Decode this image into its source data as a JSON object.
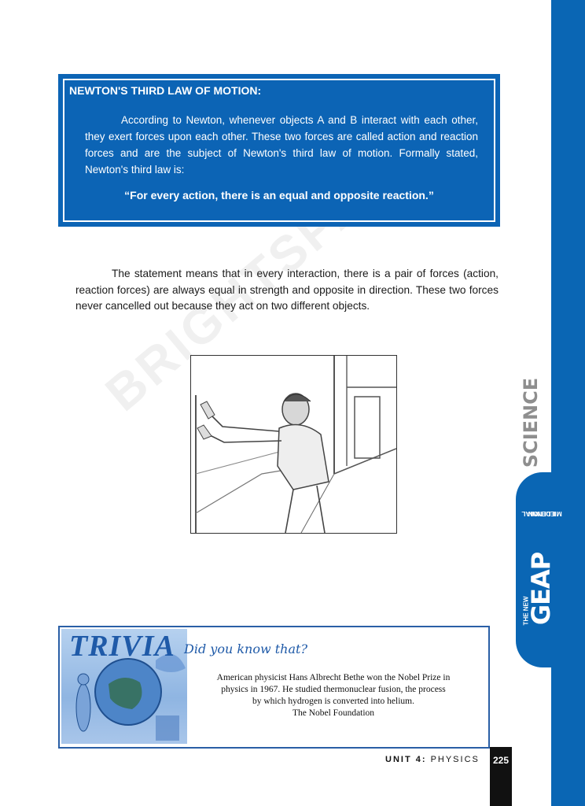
{
  "side": {
    "subject": "SCIENCE",
    "the_new": "THE NEW",
    "brand": "GEAP",
    "edition_line1": "MILLENNIAL",
    "edition_line2": "EDITION"
  },
  "law_box": {
    "title": "NEWTON'S THIRD LAW OF MOTION:",
    "body": "According to Newton, whenever objects A and B interact with each other, they exert forces upon each other. These two forces are called action and reaction forces and are the subject of Newton's third law of motion. Formally stated, Newton's third law is:",
    "quote": "“For every action, there is an equal and opposite reaction.”"
  },
  "paragraph": "The statement means that in every interaction, there is a pair of forces (action, reaction forces) are always equal in strength and opposite in direction. These two forces never cancelled out because they act on two different objects.",
  "trivia": {
    "heading": "TRIVIA",
    "subheading": "Did you know that?",
    "lines": [
      "American physicist Hans Albrecht Bethe won the Nobel Prize in",
      "physics in 1967. He studied thermonuclear fusion, the process",
      "by which hydrogen is converted into helium.",
      "The Nobel Foundation"
    ]
  },
  "footer": {
    "unit": "UNIT 4:",
    "subject": "PHYSICS",
    "page": "225"
  },
  "watermark": "BRIGHTSPARK"
}
